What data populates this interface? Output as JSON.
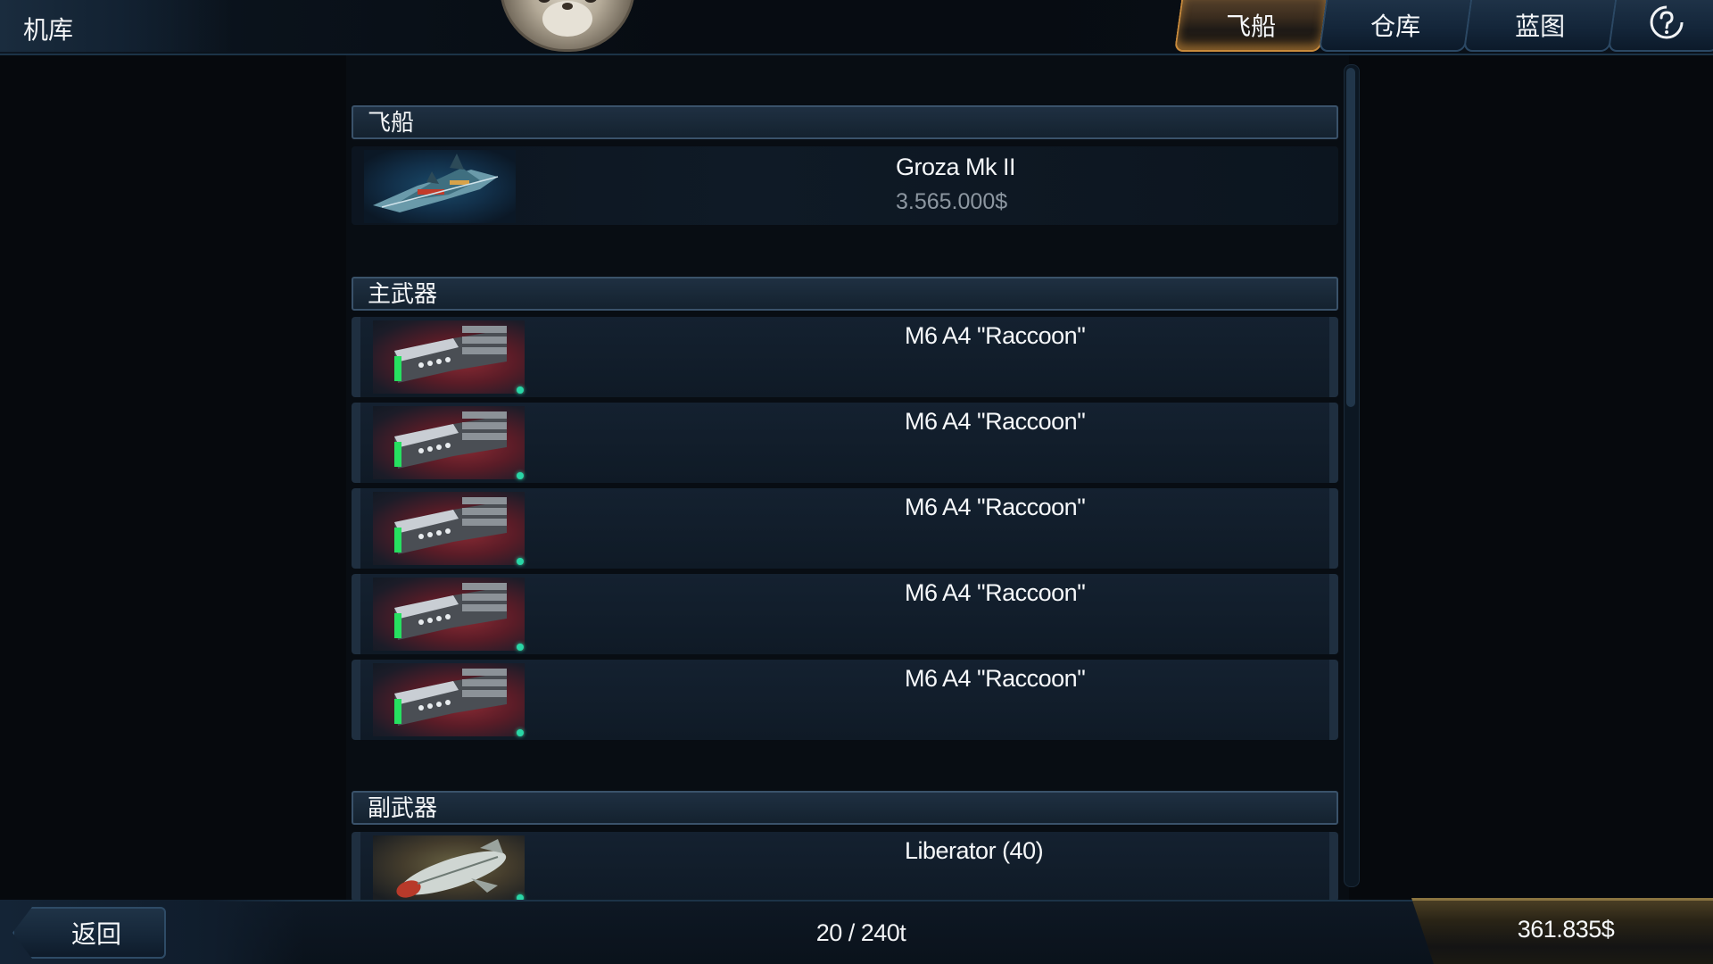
{
  "header": {
    "title": "机库",
    "tabs": [
      {
        "label": "飞船",
        "active": true
      },
      {
        "label": "仓库",
        "active": false
      },
      {
        "label": "蓝图",
        "active": false
      }
    ],
    "help_icon": "help-circle-question-icon"
  },
  "sections": {
    "ship": {
      "title": "飞船",
      "items": [
        {
          "name": "Groza Mk II",
          "price": "3.565.000$",
          "icon": "spaceship-icon"
        }
      ]
    },
    "primary_weapons": {
      "title": "主武器",
      "items": [
        {
          "name": "M6 A4 \"Raccoon\"",
          "icon": "gatling-gun-icon"
        },
        {
          "name": "M6 A4 \"Raccoon\"",
          "icon": "gatling-gun-icon"
        },
        {
          "name": "M6 A4 \"Raccoon\"",
          "icon": "gatling-gun-icon"
        },
        {
          "name": "M6 A4 \"Raccoon\"",
          "icon": "gatling-gun-icon"
        },
        {
          "name": "M6 A4 \"Raccoon\"",
          "icon": "gatling-gun-icon"
        }
      ]
    },
    "secondary_weapons": {
      "title": "副武器",
      "items": [
        {
          "name": "Liberator (40)",
          "icon": "missile-icon"
        }
      ]
    }
  },
  "footer": {
    "back_label": "返回",
    "cargo": "20 / 240t",
    "credits": "361.835$"
  },
  "colors": {
    "accent_gold": "#c88a3c",
    "panel_border": "#3a526a",
    "status_green": "#29d6a6"
  }
}
